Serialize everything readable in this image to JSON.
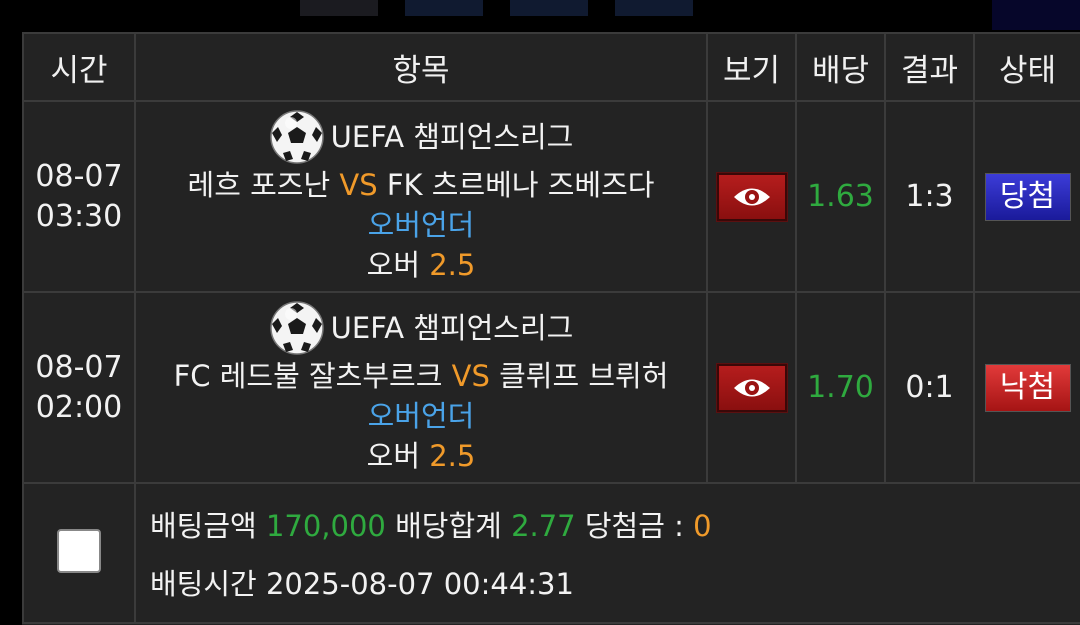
{
  "headers": {
    "time": "시간",
    "item": "항목",
    "view": "보기",
    "odds": "배당",
    "result": "결과",
    "status": "상태"
  },
  "bets": [
    {
      "date": "08-07",
      "time": "03:30",
      "league": "UEFA 챔피언스리그",
      "home": "레흐 포즈난",
      "vs": "VS",
      "away": "FK 츠르베나 즈베즈다",
      "market": "오버언더",
      "pick": "오버",
      "pick_value": "2.5",
      "odds": "1.63",
      "result": "1:3",
      "status": "당첨",
      "status_color": "#2a2ab8"
    },
    {
      "date": "08-07",
      "time": "02:00",
      "league": "UEFA 챔피언스리그",
      "home": "FC 레드불 잘츠부르크",
      "vs": "VS",
      "away": "클뤼프 브뤼허",
      "market": "오버언더",
      "pick": "오버",
      "pick_value": "2.5",
      "odds": "1.70",
      "result": "0:1",
      "status": "낙첨",
      "status_color": "#c42020"
    }
  ],
  "summary": {
    "bet_amount_label": "배팅금액",
    "bet_amount": "170,000",
    "total_odds_label": "배당합계",
    "total_odds": "2.77",
    "winnings_label": "당첨금 :",
    "winnings": "0",
    "bet_time_label": "배팅시간",
    "bet_time": "2025-08-07 00:44:31"
  },
  "icons": {
    "sport": "soccer-ball-icon",
    "view": "eye-icon"
  },
  "colors": {
    "odds": "#2faa3f",
    "vs": "#f09a2a",
    "market": "#4aa3e8"
  }
}
